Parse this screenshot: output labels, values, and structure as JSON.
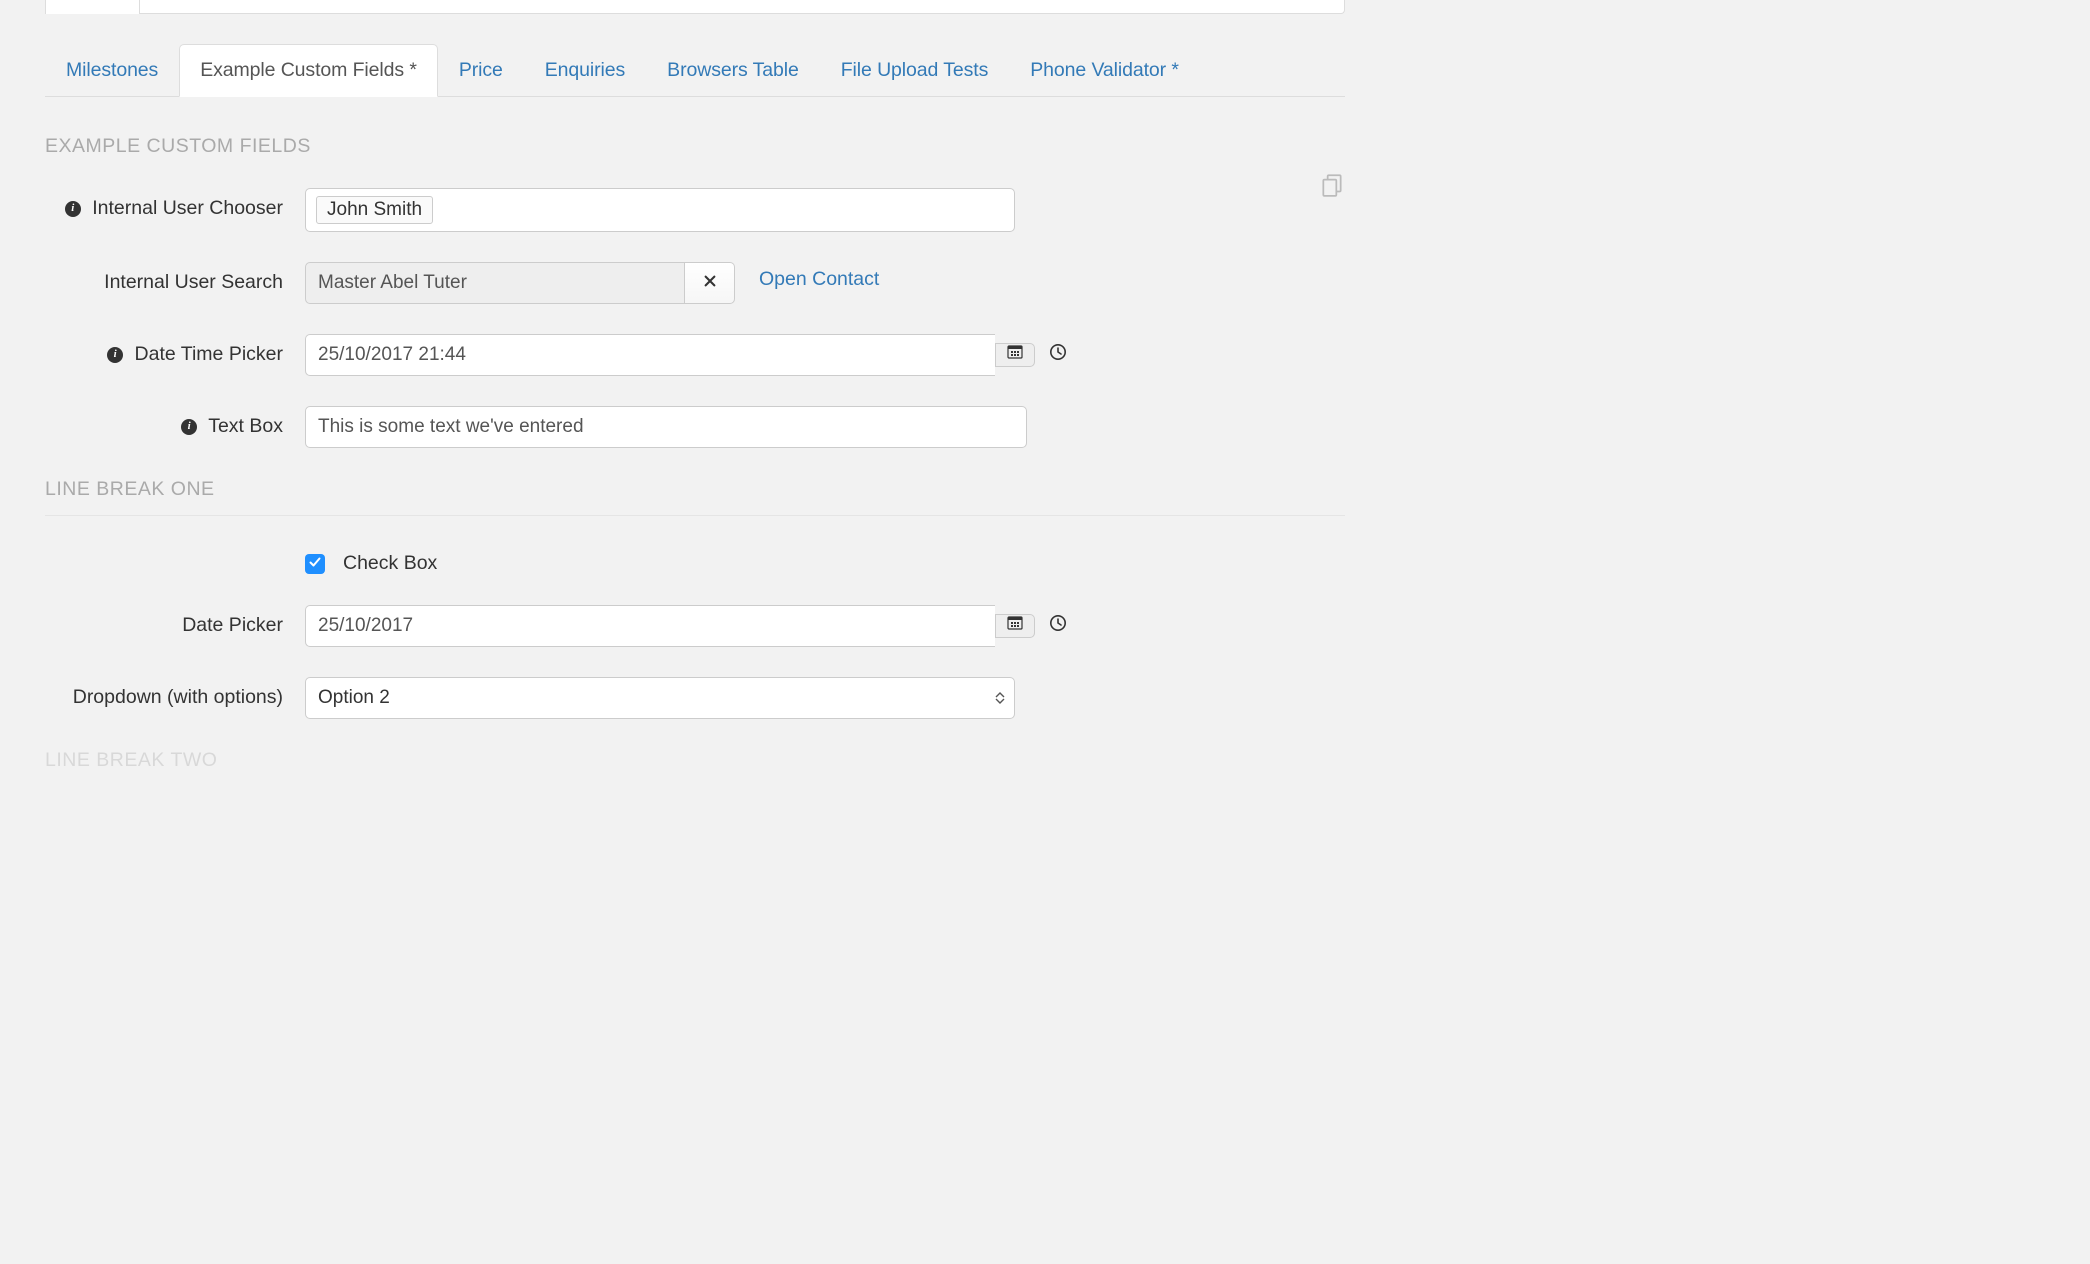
{
  "tabs": [
    "Milestones",
    "Example Custom Fields *",
    "Price",
    "Enquiries",
    "Browsers Table",
    "File Upload Tests",
    "Phone Validator *"
  ],
  "active_tab_index": 1,
  "section1": {
    "heading": "EXAMPLE CUSTOM FIELDS",
    "internal_user_chooser": {
      "label": "Internal User Chooser",
      "token": "John Smith"
    },
    "internal_user_search": {
      "label": "Internal User Search",
      "value": "Master Abel Tuter",
      "open_link": "Open Contact"
    },
    "date_time_picker": {
      "label": "Date Time Picker",
      "value": "25/10/2017 21:44"
    },
    "text_box": {
      "label": "Text Box",
      "value": "This is some text we've entered"
    }
  },
  "section2": {
    "heading": "LINE BREAK ONE",
    "checkbox": {
      "label": "Check Box",
      "checked": true
    },
    "date_picker": {
      "label": "Date Picker",
      "value": "25/10/2017"
    },
    "dropdown": {
      "label": "Dropdown (with options)",
      "selected": "Option 2"
    }
  },
  "section3": {
    "heading": "LINE BREAK TWO"
  },
  "icons": {
    "info": "info-icon",
    "copy": "copy-icon",
    "close": "close-icon",
    "calendar": "calendar-icon",
    "clock": "clock-icon",
    "check": "check-icon"
  }
}
